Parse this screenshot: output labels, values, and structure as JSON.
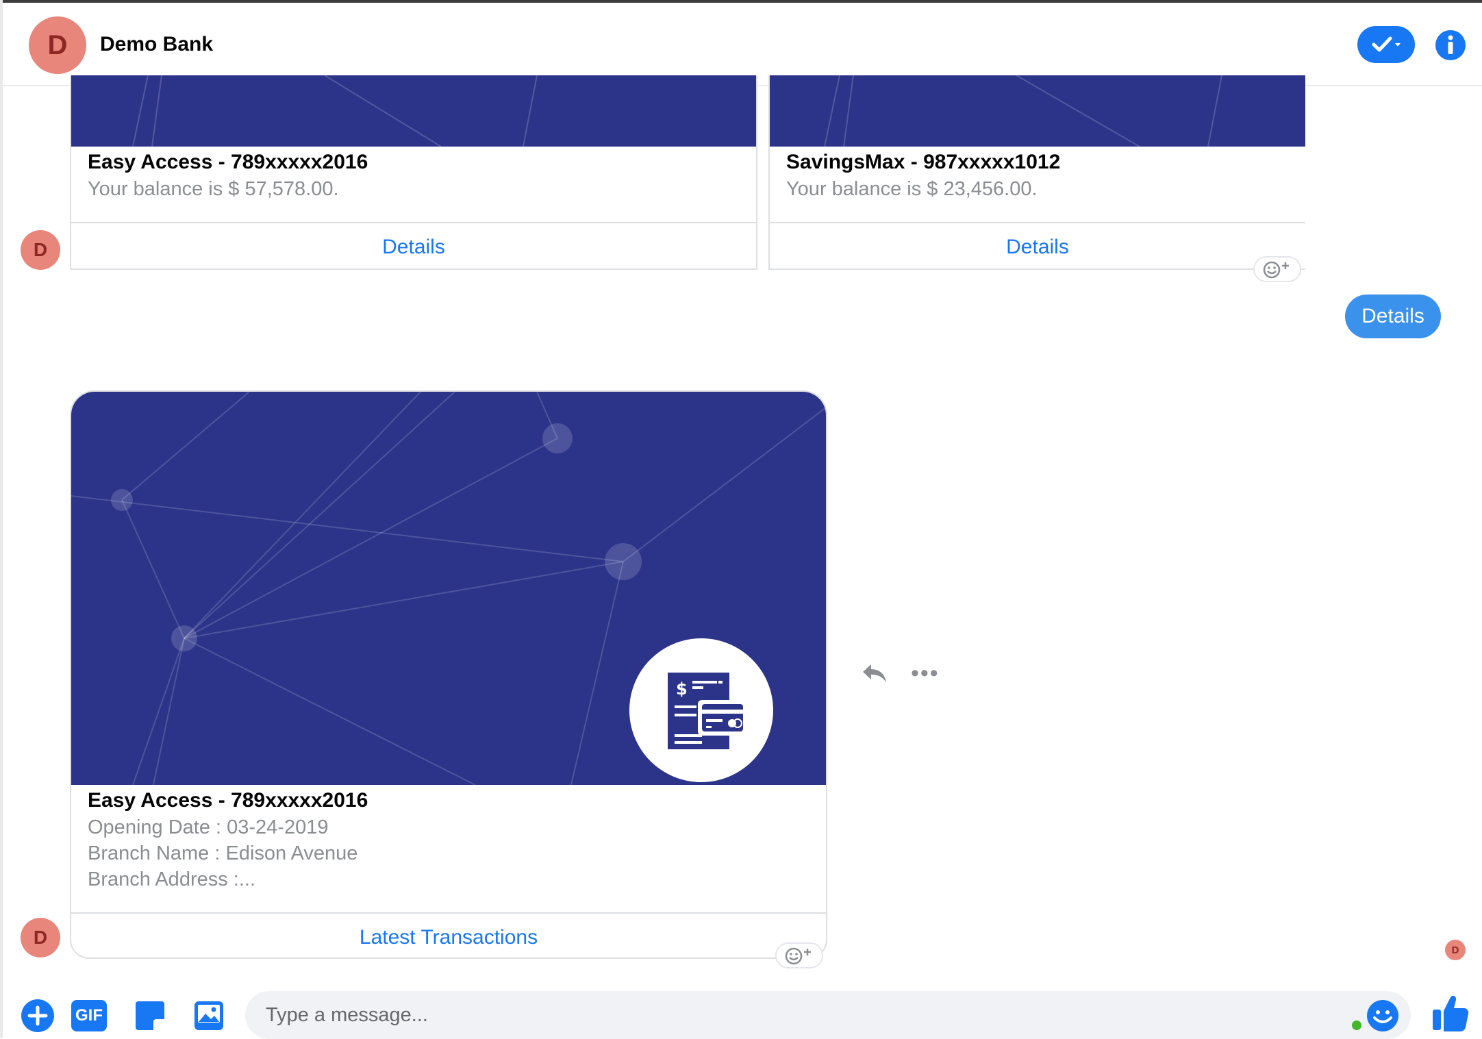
{
  "header": {
    "avatar_initial": "D",
    "title": "Demo Bank"
  },
  "avatar_initial": "D",
  "cards_row": [
    {
      "title": "Easy Access - 789xxxxx2016",
      "subtitle": "Your balance is $ 57,578.00.",
      "button": "Details"
    },
    {
      "title": "SavingsMax - 987xxxxx1012",
      "subtitle": "Your balance is $ 23,456.00.",
      "button": "Details"
    }
  ],
  "user_message": "Details",
  "detail_card": {
    "title": "Easy Access - 789xxxxx2016",
    "lines": [
      "Opening Date : 03-24-2019",
      "Branch Name : Edison Avenue",
      "Branch Address :..."
    ],
    "button": "Latest Transactions"
  },
  "message_actions": {
    "more": "•••"
  },
  "composer": {
    "placeholder": "Type a message...",
    "gif_label": "GIF"
  },
  "colors": {
    "accent": "#1877f2",
    "card_image": "#2c3489",
    "avatar": "#e8867b"
  }
}
